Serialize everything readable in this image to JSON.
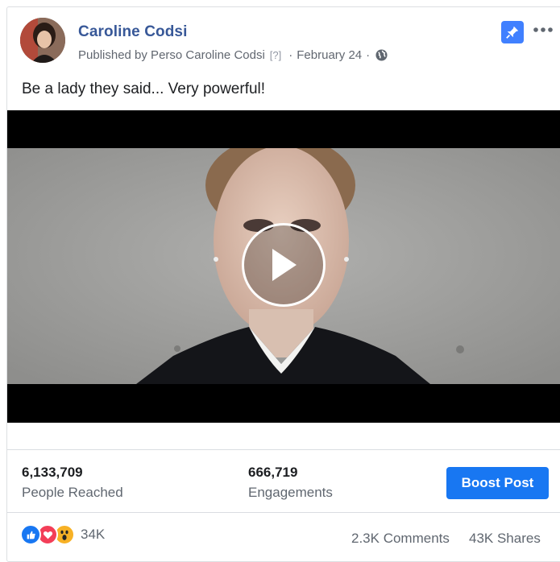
{
  "post": {
    "page_name": "Caroline Codsi",
    "published_by": "Published by Perso Caroline Codsi",
    "help_marker": "[?]",
    "separator": "·",
    "date": "February 24",
    "caption": "Be a lady they said... Very powerful!",
    "icons": {
      "avatar": "profile-photo",
      "pin": "pin-icon",
      "more": "more-options-icon",
      "audience": "globe-icon",
      "play": "play-icon"
    }
  },
  "stats": {
    "reached_value": "6,133,709",
    "reached_label": "People Reached",
    "engagements_value": "666,719",
    "engagements_label": "Engagements",
    "boost_label": "Boost Post"
  },
  "footer": {
    "reaction_count": "34K",
    "comments": "2.3K Comments",
    "shares": "43K Shares",
    "reactions": [
      "like",
      "love",
      "wow"
    ]
  },
  "colors": {
    "name": "#385898",
    "boost": "#1877f2",
    "like": "#1877f2",
    "love": "#f33e58",
    "wow": "#f7b125"
  }
}
